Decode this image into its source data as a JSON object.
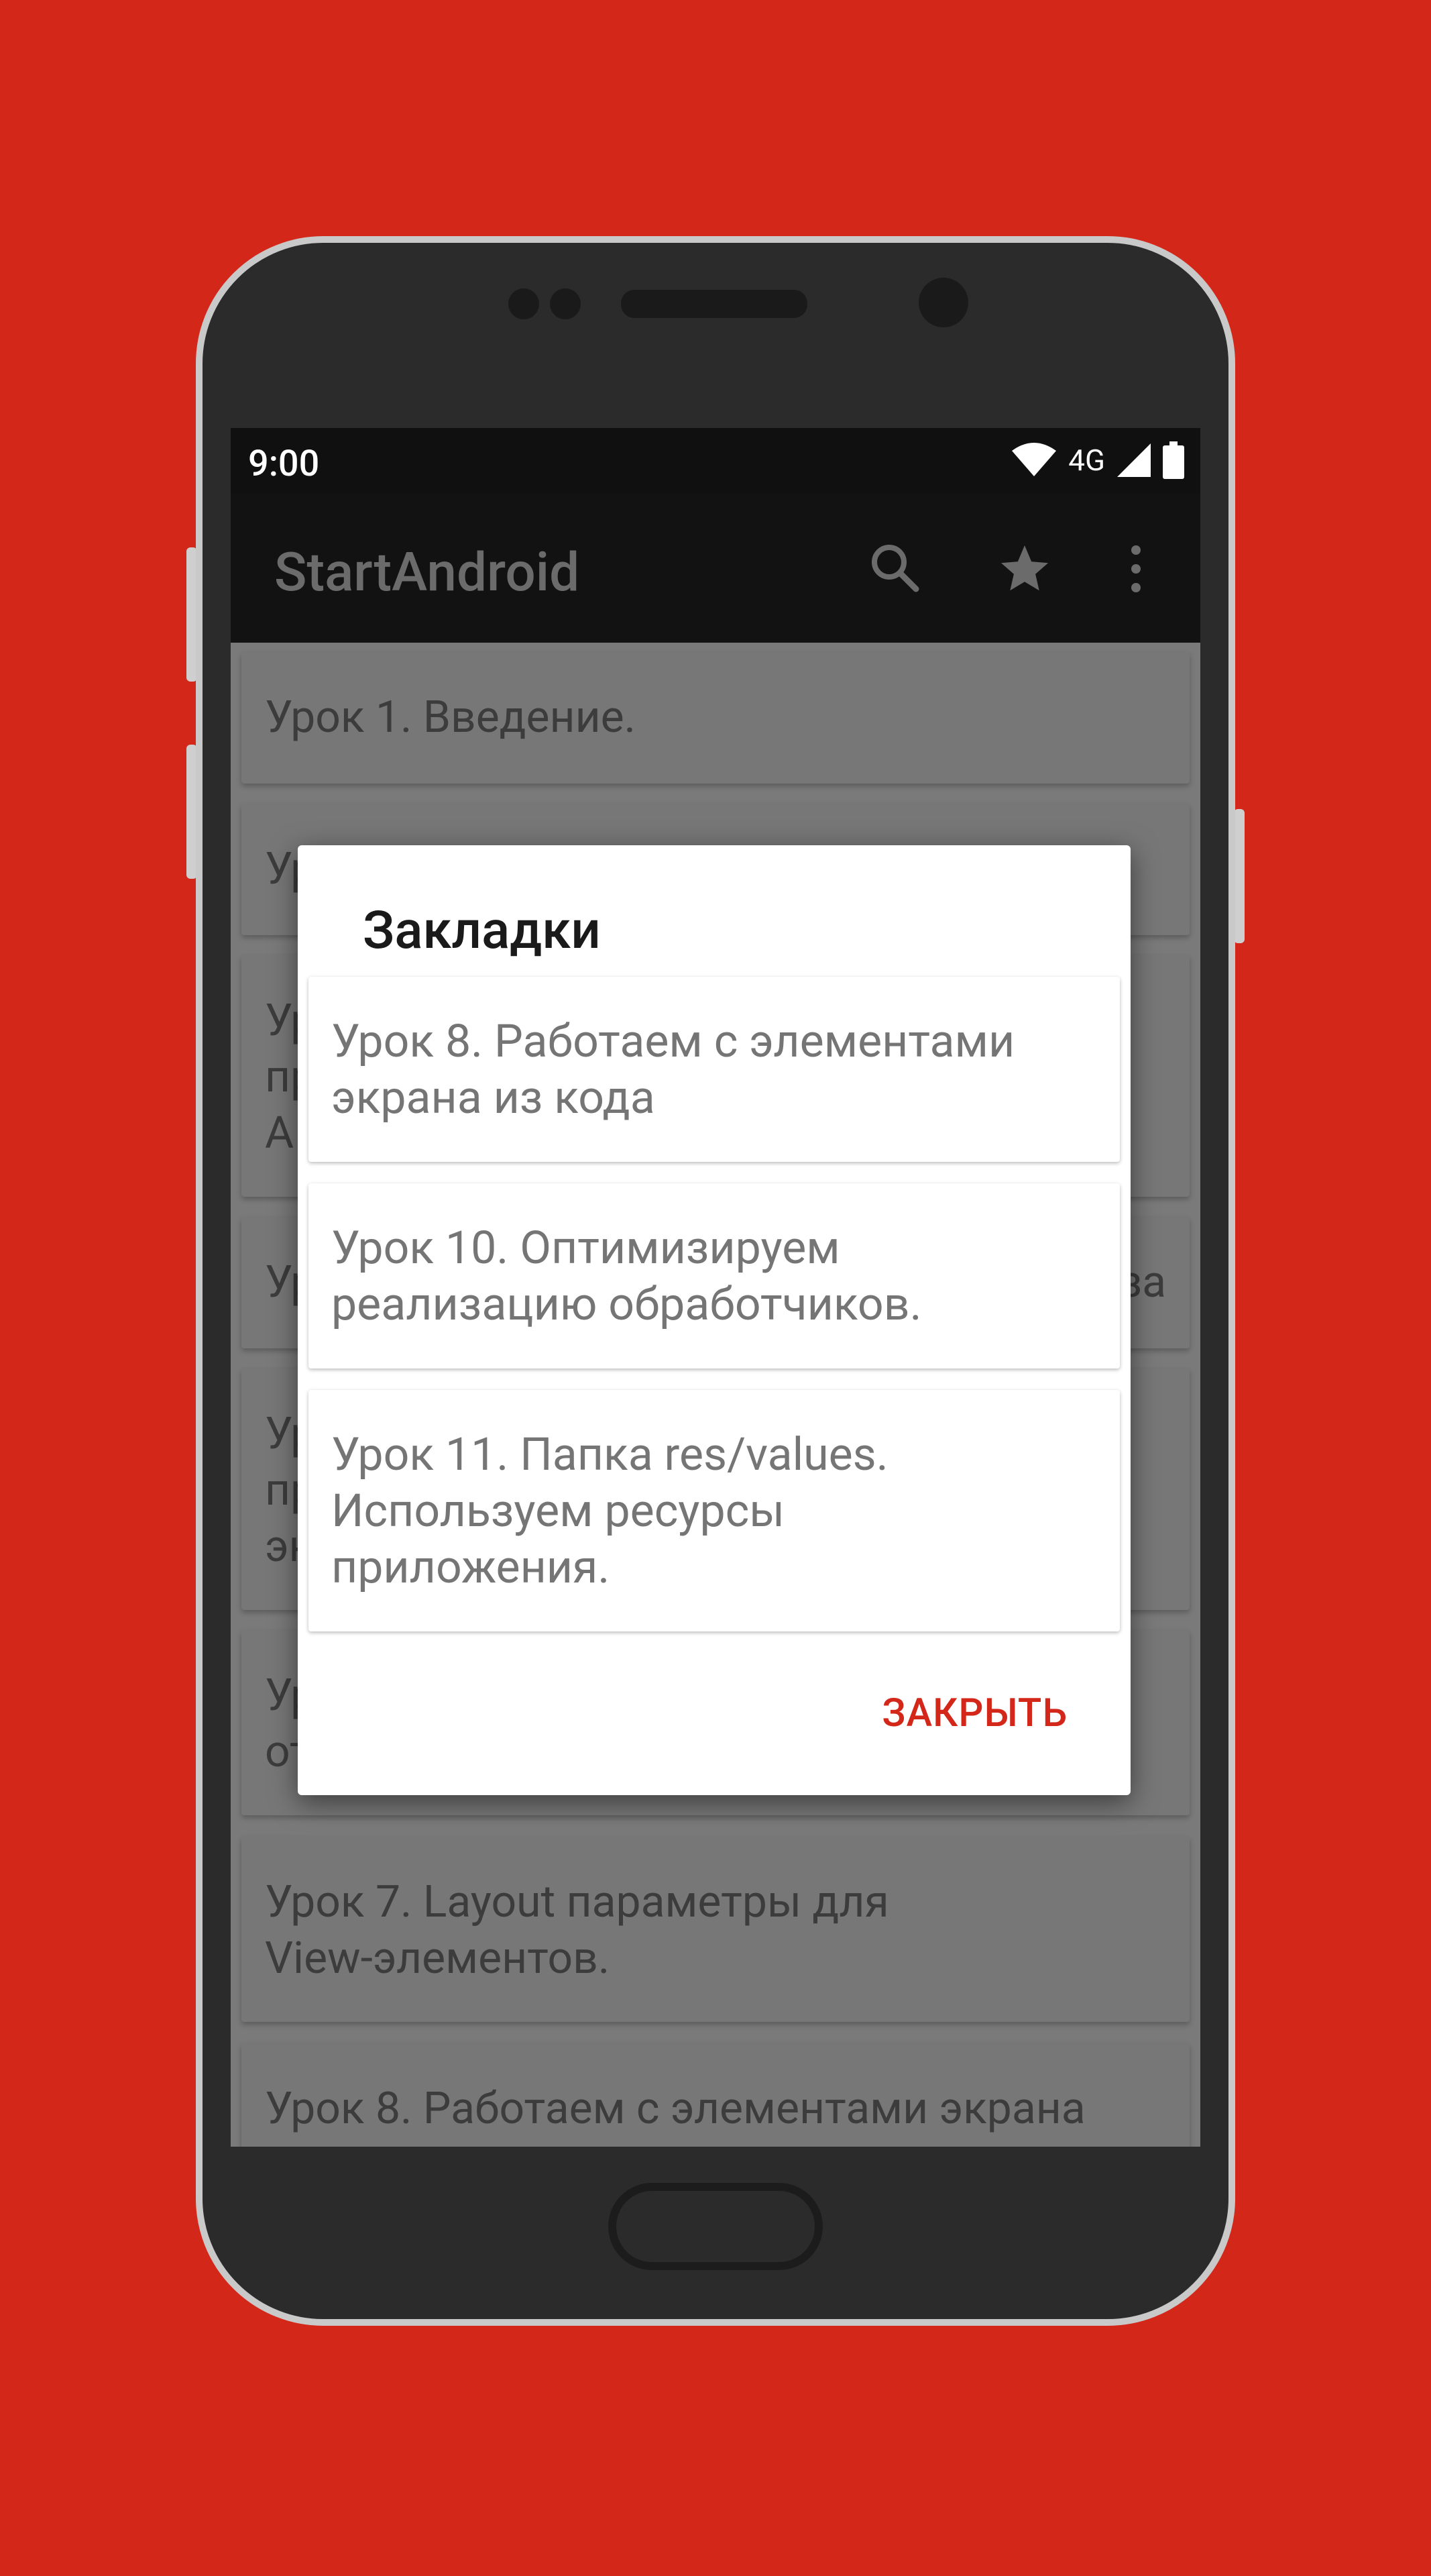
{
  "status_bar": {
    "time": "9:00",
    "network": "4G"
  },
  "app_bar": {
    "title": "StartAndroid",
    "icons": [
      "search-icon",
      "star-icon",
      "more-vert-icon"
    ]
  },
  "lessons": [
    "Урок 1. Введение.",
    "Ур",
    "Ур|пр|А",
    "Ур|за",
    "Ур|пр|эк",
    "Ур|от",
    "Урок 7. Layout параметры для|View-элементов.",
    "Урок 8. Работаем с элементами экрана"
  ],
  "dialog": {
    "title": "Закладки",
    "items": [
      [
        "Урок 8. Работаем с элементами",
        "экрана из кода"
      ],
      [
        "Урок 10. Оптимизируем",
        "реализацию обработчиков."
      ],
      [
        "Урок 11. Папка res/values.",
        "Используем ресурсы",
        "приложения."
      ]
    ],
    "close_label": "ЗАКРЫТЬ"
  },
  "colors": {
    "background": "#d32719",
    "accent": "#d32719"
  }
}
